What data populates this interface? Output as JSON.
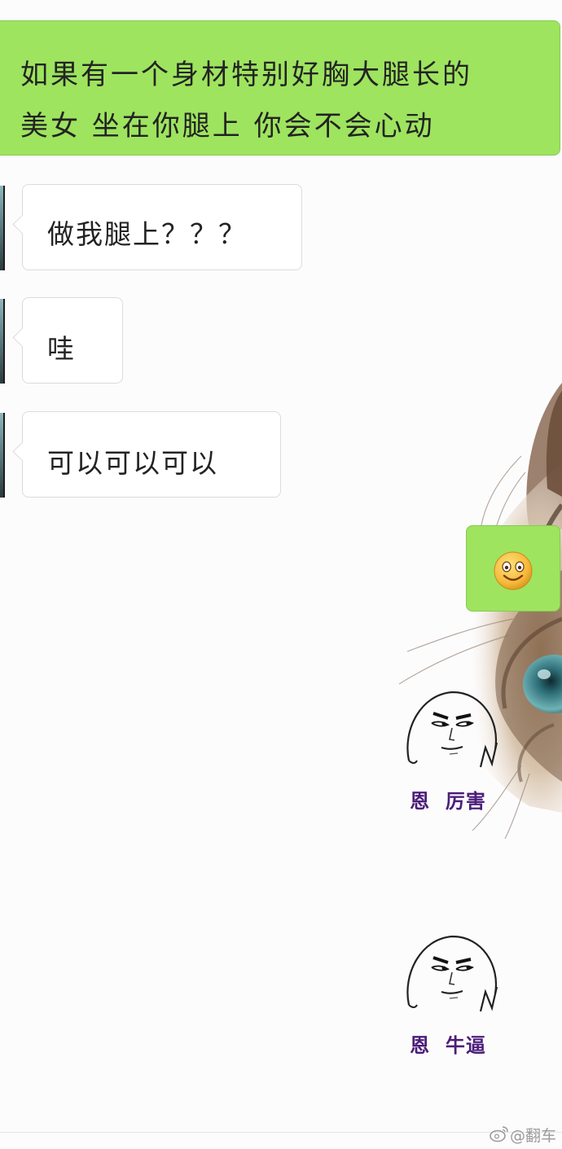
{
  "messages": [
    {
      "side": "sent",
      "lines": [
        "如果有一个身材特别好胸大腿长的",
        "美女 坐在你腿上 你会不会心动"
      ]
    },
    {
      "side": "received",
      "text": "做我腿上？？？"
    },
    {
      "side": "received",
      "text": "哇"
    },
    {
      "side": "received",
      "text": "可以可以可以"
    },
    {
      "side": "sent",
      "emoji": "smile-emoji"
    }
  ],
  "stickers": [
    {
      "caption": "恩  厉害",
      "icon": "meme-face-icon"
    },
    {
      "caption": "恩  牛逼",
      "icon": "meme-face-icon"
    }
  ],
  "watermark": {
    "text": "@翻车",
    "icon": "weibo-icon"
  },
  "colors": {
    "sent_bubble": "#9ee45f",
    "received_bubble": "#ffffff",
    "background": "#fdfcfd",
    "sticker_caption": "#4b1e7a"
  },
  "background_image": "cat-illustration"
}
